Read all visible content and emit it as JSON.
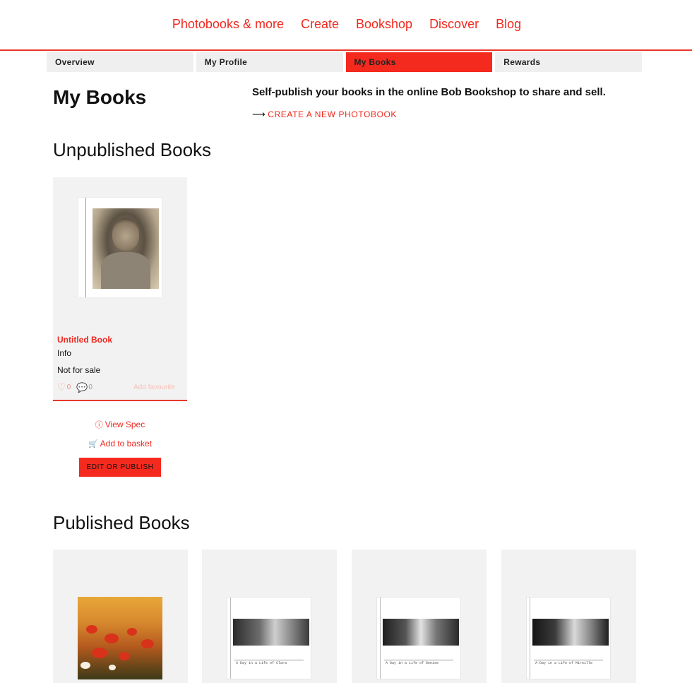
{
  "topnav": {
    "items": [
      "Photobooks & more",
      "Create",
      "Bookshop",
      "Discover",
      "Blog"
    ]
  },
  "subtabs": {
    "items": [
      "Overview",
      "My Profile",
      "My Books",
      "Rewards"
    ],
    "active": "My Books"
  },
  "header": {
    "title": "My Books",
    "intro": "Self-publish your books in the online Bob Bookshop to share and sell.",
    "create_link": "CREATE A NEW PHOTOBOOK"
  },
  "unpublished": {
    "section_title": "Unpublished Books",
    "book": {
      "title": "Untitled Book",
      "info": "Info",
      "sale": "Not for sale",
      "likes": "0",
      "comments": "0",
      "favourite": "Add favourite",
      "view_spec": "View Spec",
      "add_to_basket": "Add to basket",
      "edit_button": "EDIT OR PUBLISH"
    }
  },
  "published": {
    "section_title": "Published Books",
    "books": [
      {
        "caption": ""
      },
      {
        "caption": "A Day in a Life of Clara"
      },
      {
        "caption": "A Day in a Life of Denise"
      },
      {
        "caption": "A Day in a Life of Mireille"
      }
    ]
  },
  "colors": {
    "accent": "#f0281e",
    "card_bg": "#f2f2f2"
  }
}
